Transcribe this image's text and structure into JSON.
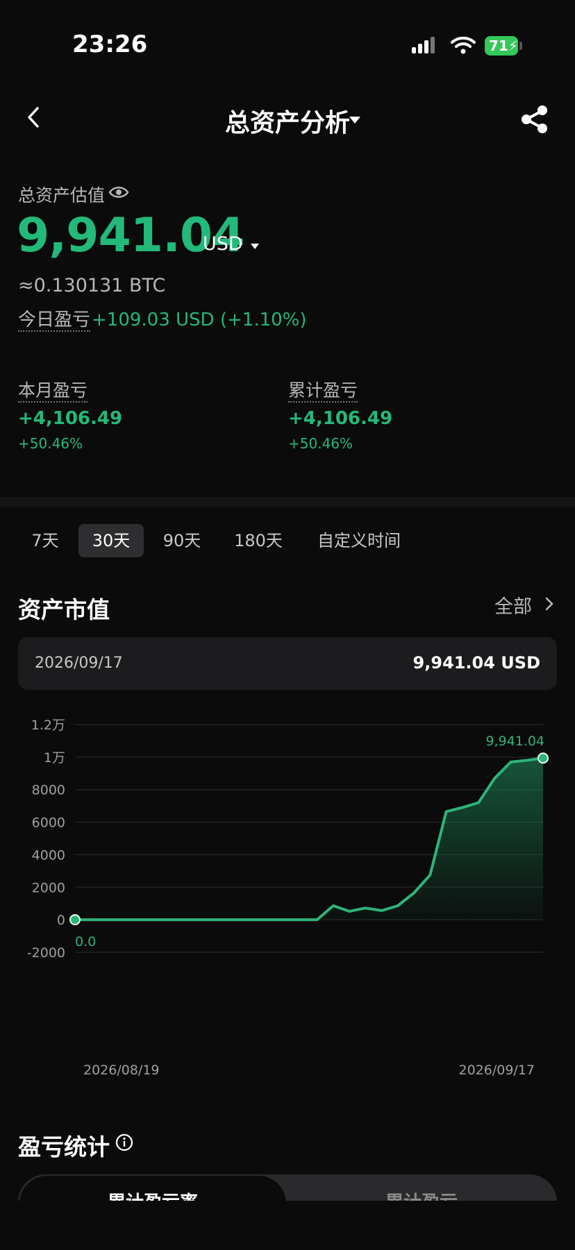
{
  "status_bar": {
    "time": "23:26",
    "battery": "71"
  },
  "nav": {
    "title": "总资产分析"
  },
  "summary": {
    "estimate_label": "总资产估值",
    "total_value": "9,941.04",
    "currency": "USD",
    "btc_equiv": "≈0.130131 BTC",
    "today_label": "今日盈亏",
    "today_value": "+109.03 USD (+1.10%)",
    "month_label": "本月盈亏",
    "month_value": "+4,106.49",
    "month_pct": "+50.46%",
    "cumulative_label": "累计盈亏",
    "cumulative_value": "+4,106.49",
    "cumulative_pct": "+50.46%"
  },
  "range_tabs": [
    {
      "label": "7天",
      "active": false
    },
    {
      "label": "30天",
      "active": true
    },
    {
      "label": "90天",
      "active": false
    },
    {
      "label": "180天",
      "active": false
    },
    {
      "label": "自定义时间",
      "active": false
    }
  ],
  "asset_section": {
    "title": "资产市值",
    "all_label": "全部",
    "selected_date": "2026/09/17",
    "selected_value": "9,941.04 USD"
  },
  "chart_data": {
    "type": "area",
    "y_ticks": [
      "1.2万",
      "1万",
      "8000",
      "6000",
      "4000",
      "2000",
      "0",
      "-2000"
    ],
    "ylim": [
      -2000,
      12000
    ],
    "x_labels": [
      "2026/08/19",
      "2026/09/17"
    ],
    "start_label": "0.0",
    "end_label": "9,941.04",
    "line_color": "#2fb37a",
    "values": [
      0,
      0,
      0,
      0,
      0,
      0,
      0,
      0,
      0,
      0,
      0,
      0,
      0,
      0,
      0,
      0,
      860,
      520,
      720,
      560,
      860,
      1650,
      2750,
      6650,
      6900,
      7200,
      8700,
      9700,
      9800,
      9941.04
    ]
  },
  "pl_section": {
    "title": "盈亏统计",
    "seg_left": "累计盈亏率",
    "seg_right": "累计盈亏"
  }
}
